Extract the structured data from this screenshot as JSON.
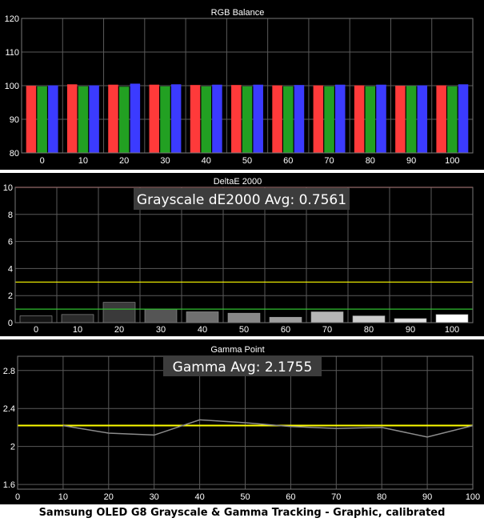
{
  "caption": "Samsung OLED G8 Grayscale & Gamma Tracking - Graphic, calibrated",
  "colors": {
    "panel_bg": "#000000",
    "grid": "#5a5a5a",
    "text": "#ffffff",
    "red": "#ff3a3a",
    "green": "#22a022",
    "blue": "#3b3bff",
    "yellow": "#ffff00",
    "limit_red": "#ff3333",
    "limit_green": "#2fc02f",
    "gamma_line": "#8c8c8c"
  },
  "chart_data": [
    {
      "type": "bar",
      "title": "RGB Balance",
      "categories": [
        "0",
        "10",
        "20",
        "30",
        "40",
        "50",
        "60",
        "70",
        "80",
        "90",
        "100"
      ],
      "series": [
        {
          "color": "red",
          "values": [
            100.0,
            100.4,
            100.3,
            100.3,
            100.2,
            100.2,
            100.1,
            100.1,
            100.1,
            100.0,
            100.1
          ]
        },
        {
          "color": "green",
          "values": [
            99.8,
            99.8,
            99.7,
            99.8,
            99.8,
            99.8,
            99.8,
            99.8,
            99.8,
            99.9,
            99.8
          ]
        },
        {
          "color": "blue",
          "values": [
            100.1,
            100.1,
            100.6,
            100.4,
            100.3,
            100.3,
            100.2,
            100.3,
            100.3,
            100.1,
            100.4
          ]
        }
      ],
      "ylim": [
        80,
        120
      ],
      "yticks": [
        "80",
        "90",
        "100",
        "110",
        "120"
      ],
      "grid": true
    },
    {
      "type": "bar",
      "title": "DeltaE 2000",
      "annotation": "Grayscale dE2000 Avg: 0.7561",
      "categories": [
        "0",
        "10",
        "20",
        "30",
        "40",
        "50",
        "60",
        "70",
        "80",
        "90",
        "100"
      ],
      "values": [
        0.5,
        0.6,
        1.5,
        1.0,
        0.8,
        0.7,
        0.4,
        0.8,
        0.5,
        0.3,
        0.6
      ],
      "bar_colors": [
        "#141414",
        "#2b2b2b",
        "#3a3a3a",
        "#555555",
        "#707070",
        "#888888",
        "#9e9e9e",
        "#b6b6b6",
        "#cccccc",
        "#e2e2e2",
        "#ffffff"
      ],
      "reference_lines": [
        {
          "y": 10,
          "color": "limit_red"
        },
        {
          "y": 3,
          "color": "yellow"
        },
        {
          "y": 1,
          "color": "limit_green"
        }
      ],
      "ylim": [
        0,
        10
      ],
      "yticks": [
        "0",
        "2",
        "4",
        "6",
        "8",
        "10"
      ],
      "grid": true
    },
    {
      "type": "line",
      "title": "Gamma Point",
      "annotation": "Gamma Avg: 2.1755",
      "x": [
        0,
        10,
        20,
        30,
        40,
        50,
        60,
        70,
        80,
        90,
        100
      ],
      "x_ticks": [
        "0",
        "10",
        "20",
        "30",
        "40",
        "50",
        "60",
        "70",
        "80",
        "90",
        "100"
      ],
      "series": [
        {
          "x": [
            10,
            20,
            30,
            40,
            50,
            60,
            70,
            80,
            90,
            100
          ],
          "values": [
            2.22,
            2.14,
            2.12,
            2.28,
            2.25,
            2.21,
            2.19,
            2.2,
            2.1,
            2.22
          ],
          "color": "gamma_line"
        }
      ],
      "target_line": {
        "y": 2.22,
        "color": "yellow"
      },
      "ylim": [
        1.55,
        2.95
      ],
      "yticks": [
        "1.6",
        "2",
        "2.4",
        "2.8"
      ],
      "xlim": [
        0,
        100
      ],
      "grid": true
    }
  ]
}
